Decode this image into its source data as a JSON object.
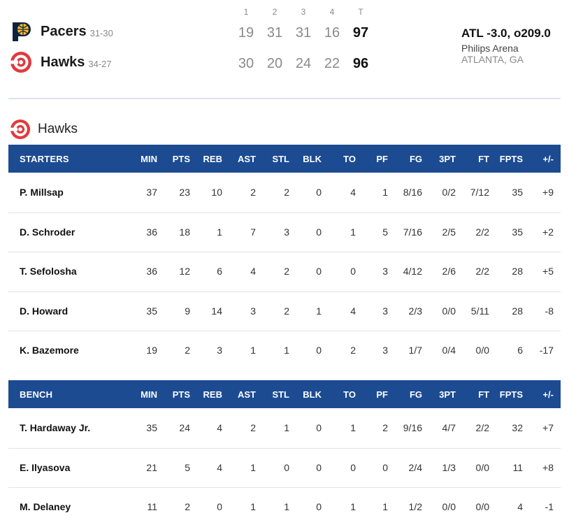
{
  "linescore": {
    "periods": [
      "1",
      "2",
      "3",
      "4",
      "T"
    ],
    "teams": [
      {
        "name": "Pacers",
        "record": "31-30",
        "scores": [
          "19",
          "31",
          "31",
          "16",
          "97"
        ],
        "logo_icon": "pacers-logo-icon",
        "color": "#0c2340"
      },
      {
        "name": "Hawks",
        "record": "34-27",
        "scores": [
          "30",
          "20",
          "24",
          "22",
          "96"
        ],
        "logo_icon": "hawks-logo-icon",
        "color": "#e03a3e"
      }
    ],
    "line": "ATL -3.0, o209.0",
    "venue": "Philips Arena",
    "city": "ATLANTA, GA"
  },
  "boxscore": {
    "team": "Hawks",
    "team_icon": "hawks-logo-icon",
    "header_color": "#1c4b92",
    "columns": [
      "MIN",
      "PTS",
      "REB",
      "AST",
      "STL",
      "BLK",
      "TO",
      "PF",
      "FG",
      "3PT",
      "FT",
      "FPTS",
      "+/-"
    ],
    "groups": [
      {
        "label": "STARTERS",
        "players": [
          {
            "name": "P. Millsap",
            "stats": [
              "37",
              "23",
              "10",
              "2",
              "2",
              "0",
              "4",
              "1",
              "8/16",
              "0/2",
              "7/12",
              "35",
              "+9"
            ]
          },
          {
            "name": "D. Schroder",
            "stats": [
              "36",
              "18",
              "1",
              "7",
              "3",
              "0",
              "1",
              "5",
              "7/16",
              "2/5",
              "2/2",
              "35",
              "+2"
            ]
          },
          {
            "name": "T. Sefolosha",
            "stats": [
              "36",
              "12",
              "6",
              "4",
              "2",
              "0",
              "0",
              "3",
              "4/12",
              "2/6",
              "2/2",
              "28",
              "+5"
            ]
          },
          {
            "name": "D. Howard",
            "stats": [
              "35",
              "9",
              "14",
              "3",
              "2",
              "1",
              "4",
              "3",
              "2/3",
              "0/0",
              "5/11",
              "28",
              "-8"
            ]
          },
          {
            "name": "K. Bazemore",
            "stats": [
              "19",
              "2",
              "3",
              "1",
              "1",
              "0",
              "2",
              "3",
              "1/7",
              "0/4",
              "0/0",
              "6",
              "-17"
            ]
          }
        ]
      },
      {
        "label": "BENCH",
        "players": [
          {
            "name": "T. Hardaway Jr.",
            "stats": [
              "35",
              "24",
              "4",
              "2",
              "1",
              "0",
              "1",
              "2",
              "9/16",
              "4/7",
              "2/2",
              "32",
              "+7"
            ]
          },
          {
            "name": "E. Ilyasova",
            "stats": [
              "21",
              "5",
              "4",
              "1",
              "0",
              "0",
              "0",
              "0",
              "2/4",
              "1/3",
              "0/0",
              "11",
              "+8"
            ]
          },
          {
            "name": "M. Delaney",
            "stats": [
              "11",
              "2",
              "0",
              "1",
              "1",
              "0",
              "1",
              "1",
              "1/2",
              "0/0",
              "0/0",
              "4",
              "-1"
            ]
          }
        ]
      }
    ]
  }
}
